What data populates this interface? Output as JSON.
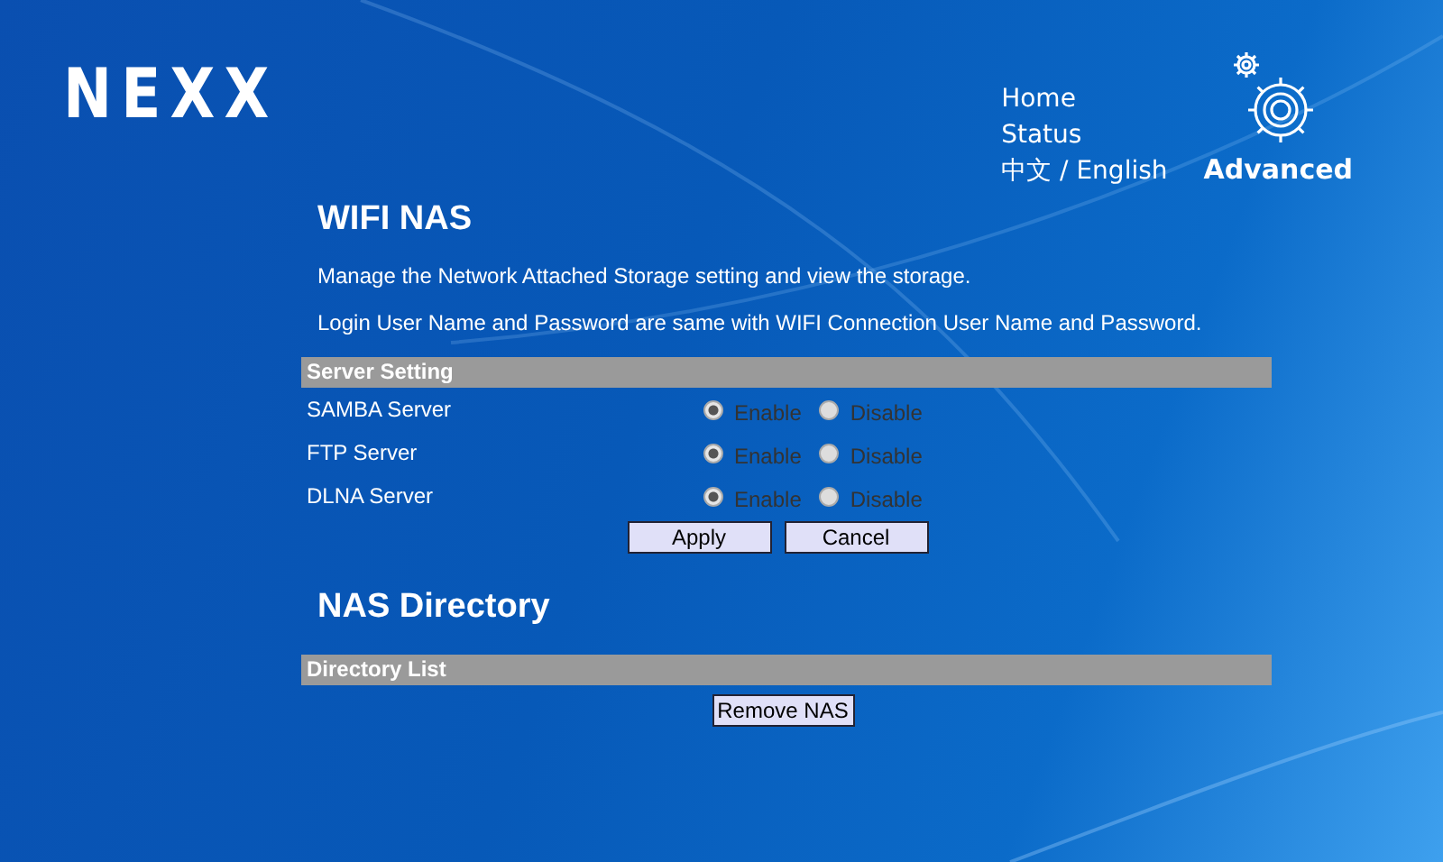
{
  "logo": "NEXX",
  "nav": [
    {
      "label": "Home"
    },
    {
      "label": "Status"
    },
    {
      "label": "中文 / English"
    }
  ],
  "advanced": {
    "label": "Advanced"
  },
  "wifi_nas": {
    "title": "WIFI NAS",
    "descriptions": [
      "Manage the Network Attached Storage setting and view the storage.",
      "Login User Name and Password are same with WIFI Connection User Name and Password."
    ],
    "section": "Server Setting",
    "servers": [
      {
        "name": "SAMBA Server",
        "options": [
          {
            "label": "Enable",
            "selected": true
          },
          {
            "label": "Disable",
            "selected": false
          }
        ]
      },
      {
        "name": "FTP Server",
        "options": [
          {
            "label": "Enable",
            "selected": true
          },
          {
            "label": "Disable",
            "selected": false
          }
        ]
      },
      {
        "name": "DLNA Server",
        "options": [
          {
            "label": "Enable",
            "selected": true
          },
          {
            "label": "Disable",
            "selected": false
          }
        ]
      }
    ],
    "buttons": [
      "Apply",
      "Cancel"
    ]
  },
  "nas_directory": {
    "title": "NAS Directory",
    "section": "Directory List",
    "button": "Remove NAS"
  }
}
